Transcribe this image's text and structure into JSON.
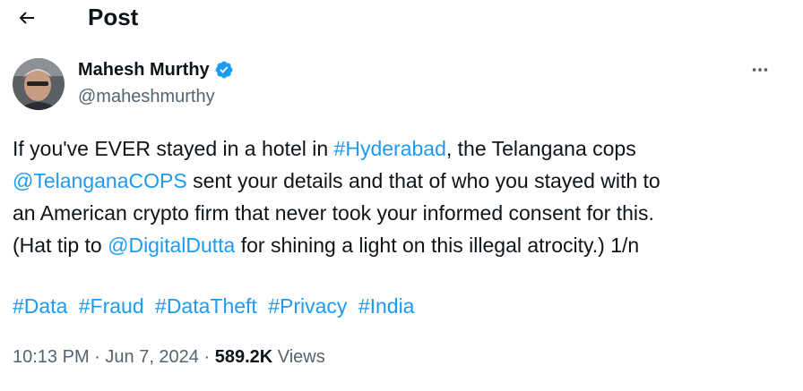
{
  "header": {
    "title": "Post",
    "back_icon": "arrow-left-icon"
  },
  "author": {
    "name": "Mahesh Murthy",
    "handle": "@maheshmurthy",
    "verified_icon": "verified-badge-icon",
    "verified_color": "#1d9bf0"
  },
  "more_icon": "more-horizontal-icon",
  "tweet": {
    "line1": {
      "pre": "If you've EVER stayed in a hotel in ",
      "link": "#Hyderabad",
      "post": ", the Telangana cops"
    },
    "line2": {
      "link": "@TelanganaCOPS",
      "post": " sent your details and that of who you stayed with to"
    },
    "line3": {
      "text": "an American crypto firm that never took your informed consent for this."
    },
    "line4": {
      "pre": "(Hat tip to ",
      "link": "@DigitalDutta",
      "post": " for shining a light on this illegal atrocity.) 1/n"
    }
  },
  "hashtags": [
    "#Data",
    "#Fraud",
    "#DataTheft",
    "#Privacy",
    "#India"
  ],
  "meta": {
    "time": "10:13 PM",
    "sep1": " · ",
    "date": "Jun 7, 2024",
    "sep2": " · ",
    "views_count": "589.2K",
    "views_label": " Views"
  },
  "colors": {
    "link": "#1d9bf0",
    "secondary_text": "#536471",
    "primary_text": "#0f1419"
  }
}
